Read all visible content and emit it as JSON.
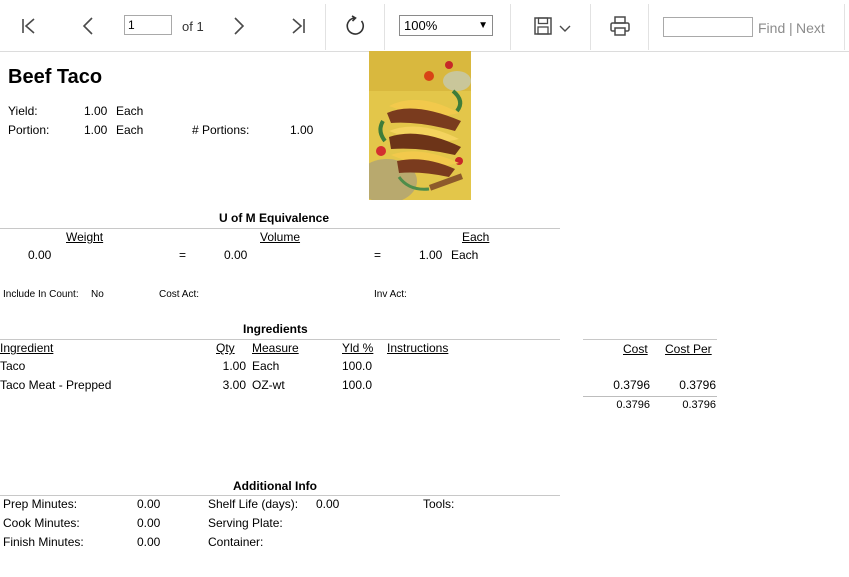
{
  "toolbar": {
    "page_value": "1",
    "page_of": "of 1",
    "zoom": "100%",
    "find_placeholder": "",
    "find_label": "Find",
    "separator": "|",
    "next_label": "Next"
  },
  "recipe": {
    "title": "Beef Taco",
    "yield_label": "Yield:",
    "yield_value": "1.00",
    "yield_unit": "Each",
    "portion_label": "Portion:",
    "portion_value": "1.00",
    "portion_unit": "Each",
    "portions_label": "# Portions:",
    "portions_value": "1.00"
  },
  "uom": {
    "title": "U of M Equivalence",
    "weight_header": "Weight",
    "volume_header": "Volume",
    "each_header": "Each",
    "weight_value": "0.00",
    "eq1": "=",
    "volume_value": "0.00",
    "eq2": "=",
    "each_value": "1.00",
    "each_unit": "Each"
  },
  "accounts": {
    "include_label": "Include In Count:",
    "include_value": "No",
    "cost_act_label": "Cost Act:",
    "inv_act_label": "Inv Act:"
  },
  "ingredients": {
    "title": "Ingredients",
    "headers": {
      "ingredient": "Ingredient",
      "qty": "Qty",
      "measure": "Measure",
      "yld": "Yld %",
      "instructions": "Instructions",
      "cost": "Cost",
      "cost_per": "Cost Per"
    },
    "rows": [
      {
        "name": "Taco",
        "qty": "1.00",
        "measure": "Each",
        "yld": "100.0",
        "cost": "",
        "cost_per": ""
      },
      {
        "name": "Taco Meat - Prepped",
        "qty": "3.00",
        "measure": "OZ-wt",
        "yld": "100.0",
        "cost": "0.3796",
        "cost_per": "0.3796"
      }
    ],
    "total_cost": "0.3796",
    "total_cost_per": "0.3796"
  },
  "additional": {
    "title": "Additional Info",
    "prep_label": "Prep Minutes:",
    "prep_value": "0.00",
    "cook_label": "Cook Minutes:",
    "cook_value": "0.00",
    "finish_label": "Finish Minutes:",
    "finish_value": "0.00",
    "shelf_label": "Shelf Life (days):",
    "shelf_value": "0.00",
    "plate_label": "Serving Plate:",
    "container_label": "Container:",
    "tools_label": "Tools:"
  },
  "icons": {
    "first": "first-page-icon",
    "prev": "previous-page-icon",
    "next": "next-page-icon",
    "last": "last-page-icon",
    "refresh": "refresh-icon",
    "save": "save-icon",
    "print": "print-icon"
  },
  "colors": {
    "icon": "#4a4a4a",
    "link": "#8c8c8c",
    "rule": "#c8c8c8"
  }
}
